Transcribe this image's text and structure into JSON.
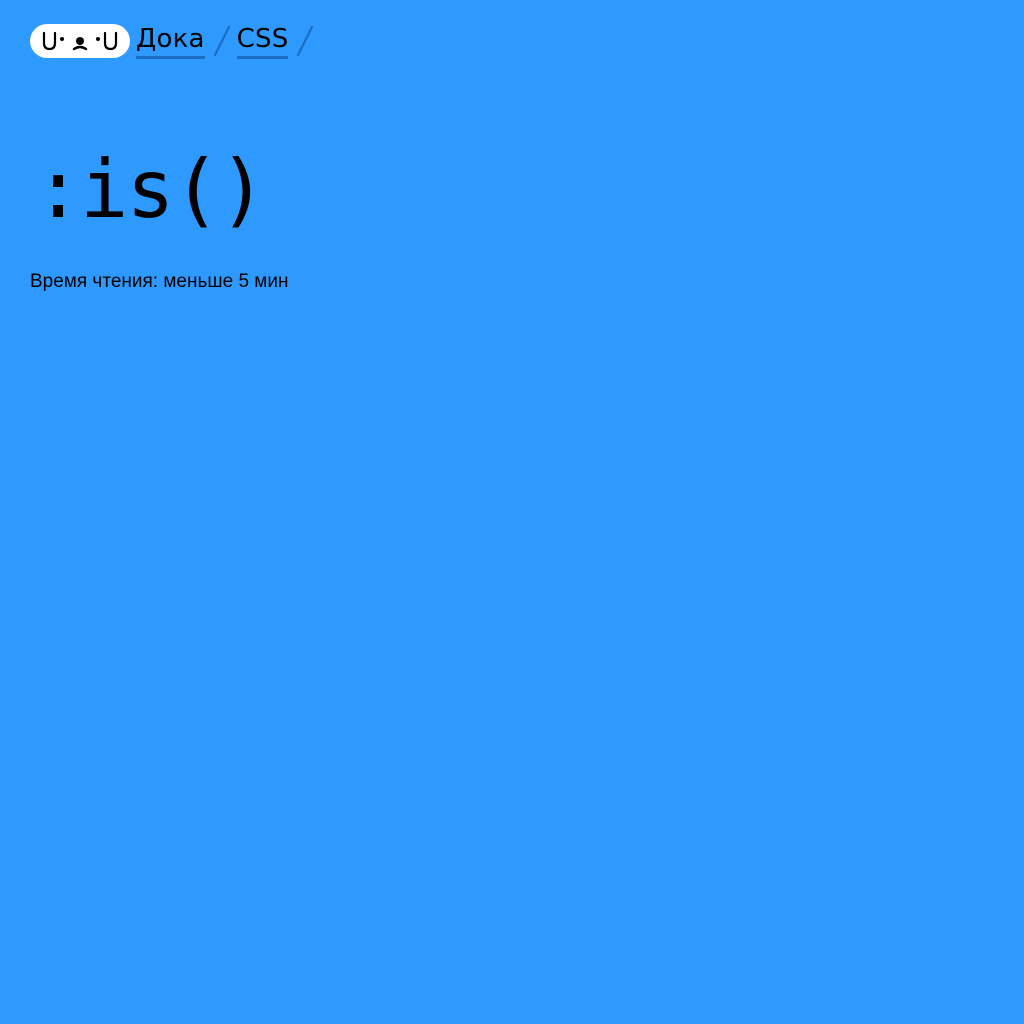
{
  "header": {
    "logo_icon": "doka-face-logo-icon",
    "breadcrumbs": [
      {
        "label": "Дока"
      },
      {
        "label": "CSS"
      }
    ],
    "separator_icon": "slash-separator-icon"
  },
  "article": {
    "title": ":is()",
    "reading_time": "Время чтения: меньше 5 мин"
  },
  "colors": {
    "background": "#2e99ff",
    "text": "#000000",
    "logo_bg": "#ffffff",
    "link_underline": "#1c6ec4",
    "separator": "#1c6ec4"
  }
}
